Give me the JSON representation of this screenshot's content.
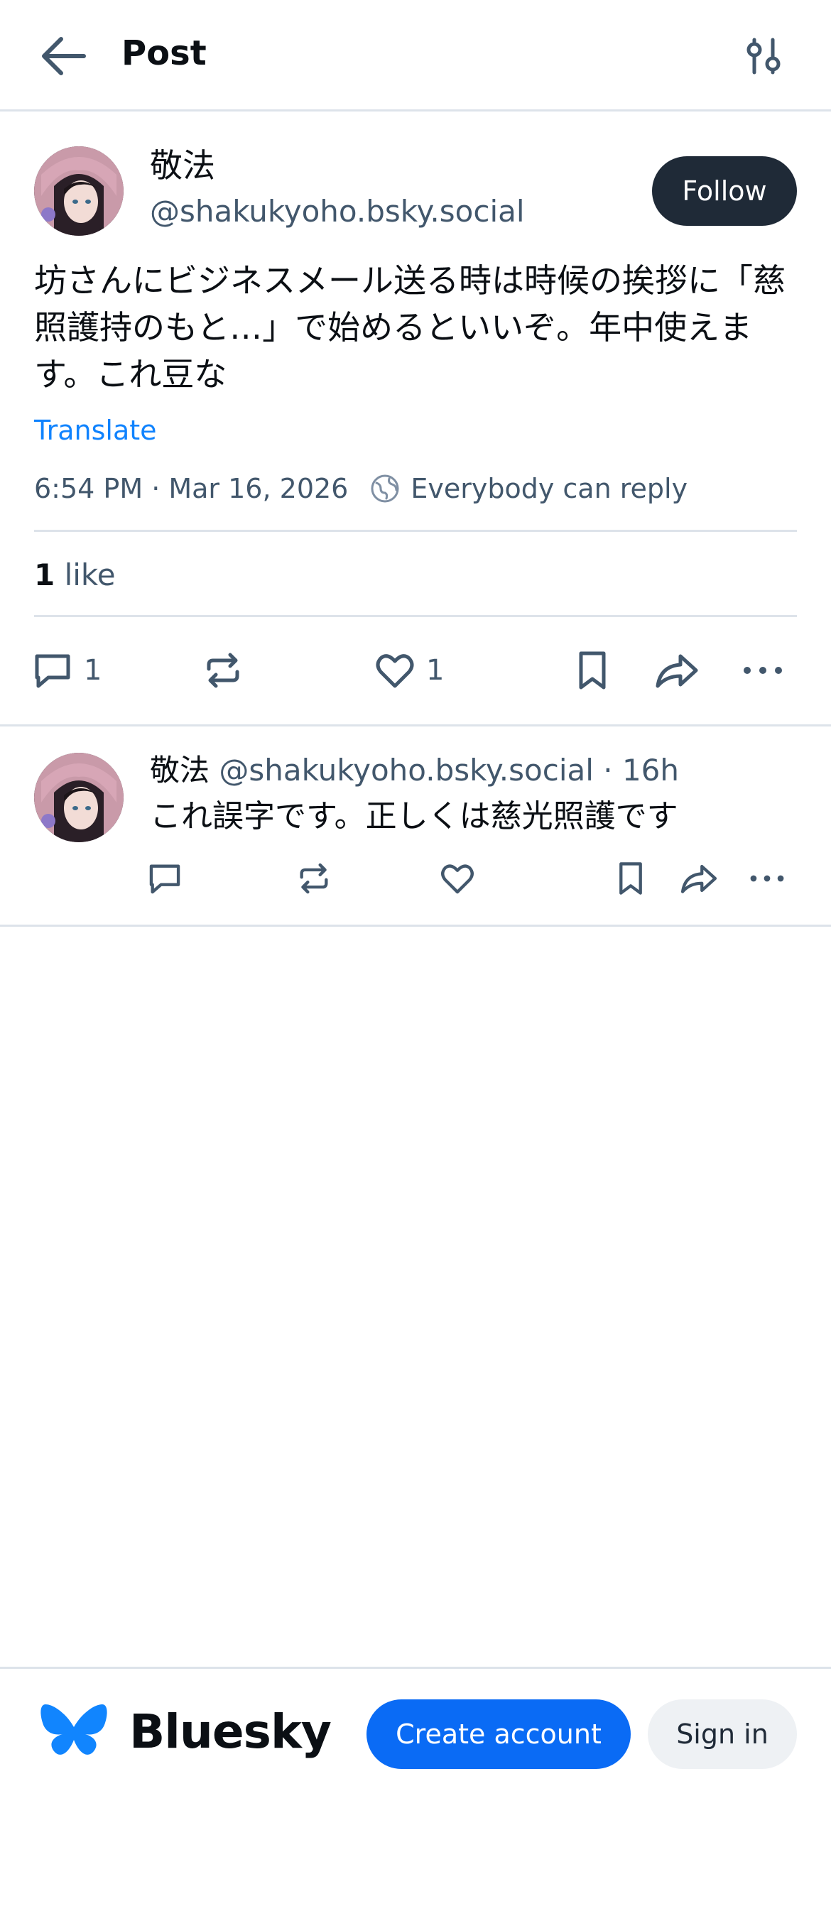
{
  "header": {
    "title": "Post",
    "back_icon": "arrow-left-icon",
    "filter_icon": "sliders-icon"
  },
  "post": {
    "author": {
      "name": "敬法",
      "handle": "@shakukyoho.bsky.social",
      "avatar": "avatar-image"
    },
    "follow_label": "Follow",
    "text": "坊さんにビジネスメール送る時は時候の挨拶に「慈照護持のもと…」で始めるといいぞ。年中使えます。これ豆な",
    "translate_label": "Translate",
    "timestamp": "6:54 PM · Mar 16, 2026",
    "reply_setting": "Everybody can reply",
    "likes": {
      "count": "1",
      "label": "like"
    },
    "actions": {
      "reply_count": "1",
      "like_count": "1"
    }
  },
  "reply": {
    "author_name": "敬法",
    "handle_time": "@shakukyoho.bsky.social · 16h",
    "text": "これ誤字です。正しくは慈光照護です"
  },
  "bottom_bar": {
    "brand": "Bluesky",
    "create_account_label": "Create account",
    "sign_in_label": "Sign in"
  },
  "colors": {
    "accent": "#0a6bf5",
    "link": "#1083fe",
    "muted_text": "#42576c",
    "follow_bg": "#1f2a37",
    "divider": "#dde3ea"
  }
}
